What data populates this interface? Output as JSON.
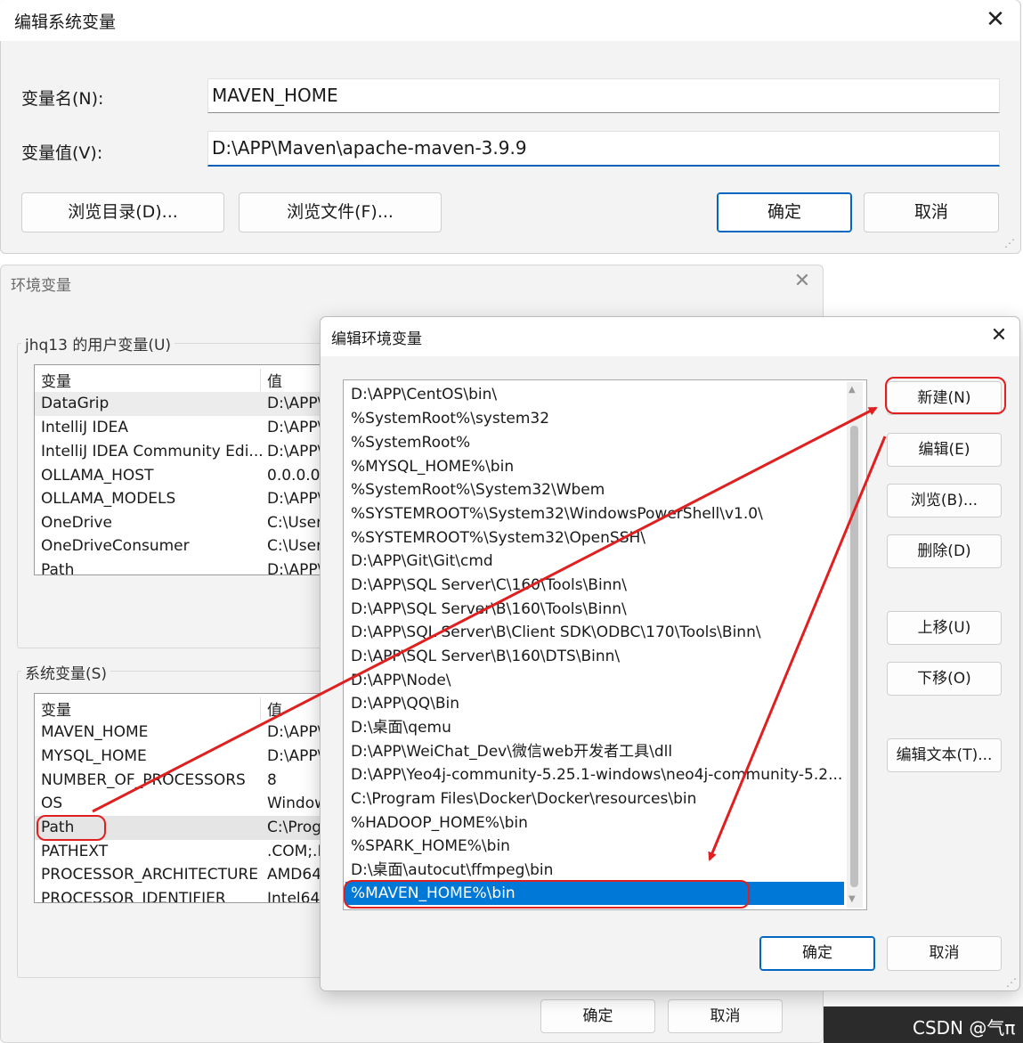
{
  "top_dialog": {
    "title": "编辑系统变量",
    "close": "✕",
    "name_label": "变量名(N):",
    "name_value": "MAVEN_HOME",
    "value_label": "变量值(V):",
    "value_value": "D:\\APP\\Maven\\apache-maven-3.9.9",
    "browse_dir": "浏览目录(D)...",
    "browse_file": "浏览文件(F)...",
    "ok": "确定",
    "cancel": "取消"
  },
  "env_dialog": {
    "title": "环境变量",
    "close": "✕",
    "user_group": "jhq13 的用户变量(U)",
    "system_group": "系统变量(S)",
    "col_var": "变量",
    "col_val": "值",
    "user_vars": [
      {
        "name": "DataGrip",
        "value": "D:\\APP\\"
      },
      {
        "name": "IntelliJ IDEA",
        "value": "D:\\APP\\"
      },
      {
        "name": "IntelliJ IDEA Community Edi...",
        "value": "D:\\APP\\"
      },
      {
        "name": "OLLAMA_HOST",
        "value": "0.0.0.0"
      },
      {
        "name": "OLLAMA_MODELS",
        "value": "D:\\APP\\"
      },
      {
        "name": "OneDrive",
        "value": "C:\\User"
      },
      {
        "name": "OneDriveConsumer",
        "value": "C:\\User"
      },
      {
        "name": "Path",
        "value": "D:\\APP\\"
      }
    ],
    "system_vars": [
      {
        "name": "MAVEN_HOME",
        "value": "D:\\APP\\"
      },
      {
        "name": "MYSQL_HOME",
        "value": "D:\\APP\\"
      },
      {
        "name": "NUMBER_OF_PROCESSORS",
        "value": "8"
      },
      {
        "name": "OS",
        "value": "Window"
      },
      {
        "name": "Path",
        "value": "C:\\Prog"
      },
      {
        "name": "PATHEXT",
        "value": ".COM;.E"
      },
      {
        "name": "PROCESSOR_ARCHITECTURE",
        "value": "AMD64"
      },
      {
        "name": "PROCESSOR_IDENTIFIER",
        "value": "Intel64"
      }
    ],
    "ok": "确定",
    "cancel": "取消"
  },
  "edit_dialog": {
    "title": "编辑环境变量",
    "close": "✕",
    "paths": [
      "D:\\APP\\CentOS\\bin\\",
      "%SystemRoot%\\system32",
      "%SystemRoot%",
      "%MYSQL_HOME%\\bin",
      "%SystemRoot%\\System32\\Wbem",
      "%SYSTEMROOT%\\System32\\WindowsPowerShell\\v1.0\\",
      "%SYSTEMROOT%\\System32\\OpenSSH\\",
      "D:\\APP\\Git\\Git\\cmd",
      "D:\\APP\\SQL Server\\C\\160\\Tools\\Binn\\",
      "D:\\APP\\SQL Server\\B\\160\\Tools\\Binn\\",
      "D:\\APP\\SQL Server\\B\\Client SDK\\ODBC\\170\\Tools\\Binn\\",
      "D:\\APP\\SQL Server\\B\\160\\DTS\\Binn\\",
      "D:\\APP\\Node\\",
      "D:\\APP\\QQ\\Bin",
      "D:\\桌面\\qemu",
      "D:\\APP\\WeiChat_Dev\\微信web开发者工具\\dll",
      "D:\\APP\\Yeo4j-community-5.25.1-windows\\neo4j-community-5.2...",
      "C:\\Program Files\\Docker\\Docker\\resources\\bin",
      "%HADOOP_HOME%\\bin",
      "%SPARK_HOME%\\bin",
      "D:\\桌面\\autocut\\ffmpeg\\bin",
      "%MAVEN_HOME%\\bin"
    ],
    "buttons": {
      "new": "新建(N)",
      "edit": "编辑(E)",
      "browse": "浏览(B)...",
      "delete": "删除(D)",
      "move_up": "上移(U)",
      "move_down": "下移(O)",
      "edit_text": "编辑文本(T)..."
    },
    "ok": "确定",
    "cancel": "取消"
  },
  "watermark": "CSDN @气π",
  "colors": {
    "accent": "#0078d7",
    "highlight": "#e02020"
  }
}
